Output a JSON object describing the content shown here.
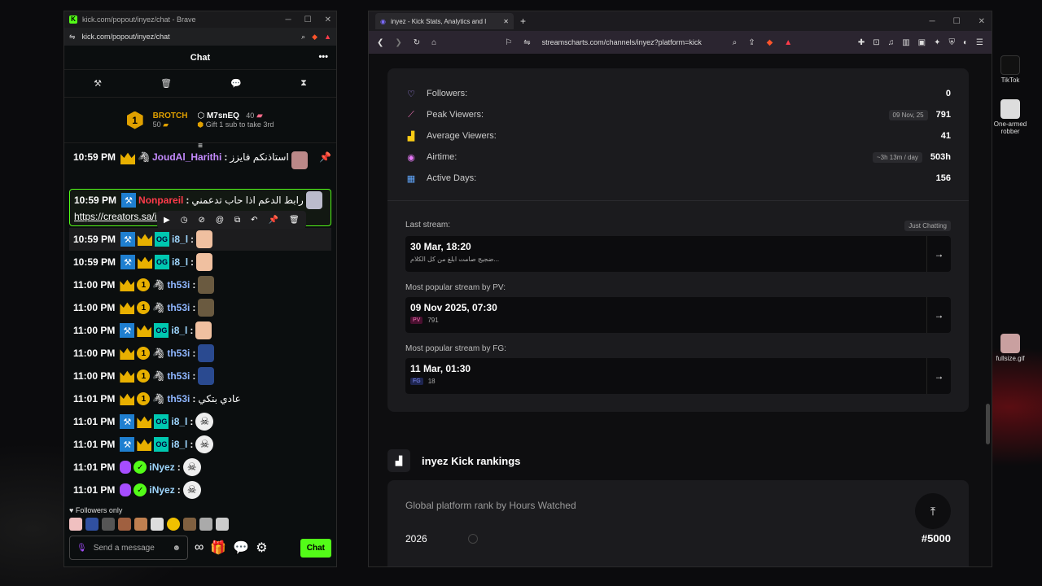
{
  "chat_window": {
    "title": "kick.com/popout/inyez/chat - Brave",
    "url": "kick.com/popout/inyez/chat",
    "header": "Chat",
    "leaderboard": {
      "first_name": "BROTCH",
      "first_count": "50",
      "second_name": "M7snEQ",
      "second_count": "40",
      "gift_text": "Gift 1 sub to take 3rd"
    },
    "messages": [
      {
        "time": "10:59 PM",
        "user": "JoudAl_Harithi",
        "text": "استاذنكم فايزز",
        "color": "#c58bff"
      },
      {
        "time": "10:59 PM",
        "user": "Nonpareil",
        "text": "رابط الدعم اذا حاب تدعمني",
        "link": "https://creators.sa/inyez",
        "color": "#ff3b4a"
      },
      {
        "time": "10:59 PM",
        "user": "i8_l",
        "color": "#9fd7ff"
      },
      {
        "time": "10:59 PM",
        "user": "i8_l",
        "color": "#9fd7ff"
      },
      {
        "time": "11:00 PM",
        "user": "th53i",
        "color": "#8fb6ff"
      },
      {
        "time": "11:00 PM",
        "user": "th53i",
        "color": "#8fb6ff"
      },
      {
        "time": "11:00 PM",
        "user": "i8_l",
        "color": "#9fd7ff"
      },
      {
        "time": "11:00 PM",
        "user": "th53i",
        "color": "#8fb6ff"
      },
      {
        "time": "11:00 PM",
        "user": "th53i",
        "color": "#8fb6ff"
      },
      {
        "time": "11:01 PM",
        "user": "th53i",
        "text": "عادي بتكي",
        "color": "#8fb6ff"
      },
      {
        "time": "11:01 PM",
        "user": "i8_l",
        "color": "#9fd7ff"
      },
      {
        "time": "11:01 PM",
        "user": "i8_l",
        "color": "#9fd7ff"
      },
      {
        "time": "11:01 PM",
        "user": "iNyez",
        "color": "#9fd7ff"
      },
      {
        "time": "11:01 PM",
        "user": "iNyez",
        "color": "#9fd7ff"
      }
    ],
    "followers_only": "Followers only",
    "input_placeholder": "Send a message",
    "chat_button": "Chat"
  },
  "browser": {
    "tab_title": "inyez - Kick Stats, Analytics and I",
    "url": "streamscharts.com/channels/inyez?platform=kick",
    "stats": [
      {
        "label": "Followers:",
        "value": "0",
        "tag": ""
      },
      {
        "label": "Peak Viewers:",
        "value": "791",
        "tag": "09 Nov, 25"
      },
      {
        "label": "Average Viewers:",
        "value": "41",
        "tag": ""
      },
      {
        "label": "Airtime:",
        "value": "503h",
        "tag": "~3h 13m / day"
      },
      {
        "label": "Active Days:",
        "value": "156",
        "tag": ""
      }
    ],
    "last_stream": {
      "label": "Last stream:",
      "tag": "Just Chatting",
      "date": "30 Mar, 18:20",
      "title": "ضجيج صامت ابلغ من كل الكلام..."
    },
    "popular_pv": {
      "label": "Most popular stream by PV:",
      "date": "09 Nov 2025, 07:30",
      "chip": "PV",
      "value": "791"
    },
    "popular_fg": {
      "label": "Most popular stream by FG:",
      "date": "11 Mar, 01:30",
      "chip": "FG",
      "value": "18"
    },
    "rankings_title": "inyez Kick rankings",
    "rank_card": {
      "title": "Global platform rank by Hours Watched",
      "year": "2026",
      "rank": "#5000"
    }
  },
  "desktop": {
    "icons": [
      "TikTok",
      "One-armed robber",
      "fullsize.gif"
    ]
  }
}
